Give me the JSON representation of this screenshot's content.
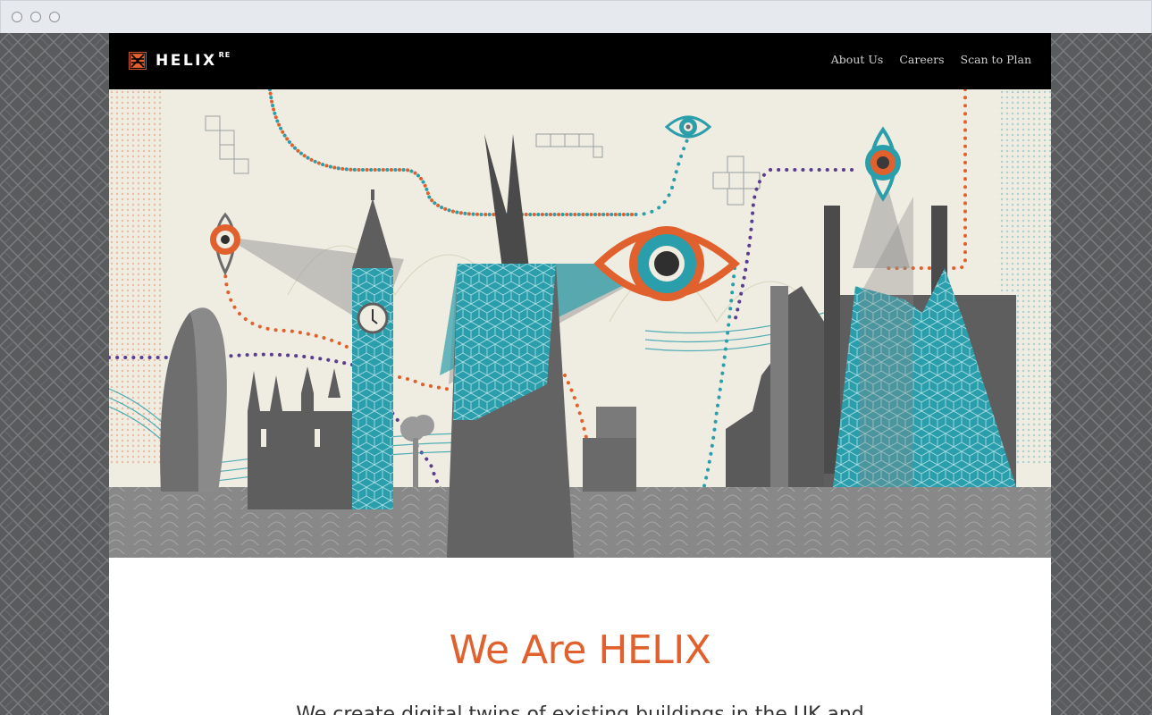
{
  "brand": {
    "name": "HELIX",
    "suffix": "RE",
    "accent": "#e0612d",
    "teal": "#2b9eab"
  },
  "nav": {
    "items": [
      {
        "label": "About Us"
      },
      {
        "label": "Careers"
      },
      {
        "label": "Scan to Plan"
      }
    ]
  },
  "hero": {
    "icons": [
      "eye-icon",
      "gherkin-building",
      "big-ben-building",
      "shard-building",
      "power-station-building"
    ]
  },
  "main": {
    "headline": "We Are HELIX",
    "intro": "We create digital twins of existing buildings in the UK and"
  }
}
